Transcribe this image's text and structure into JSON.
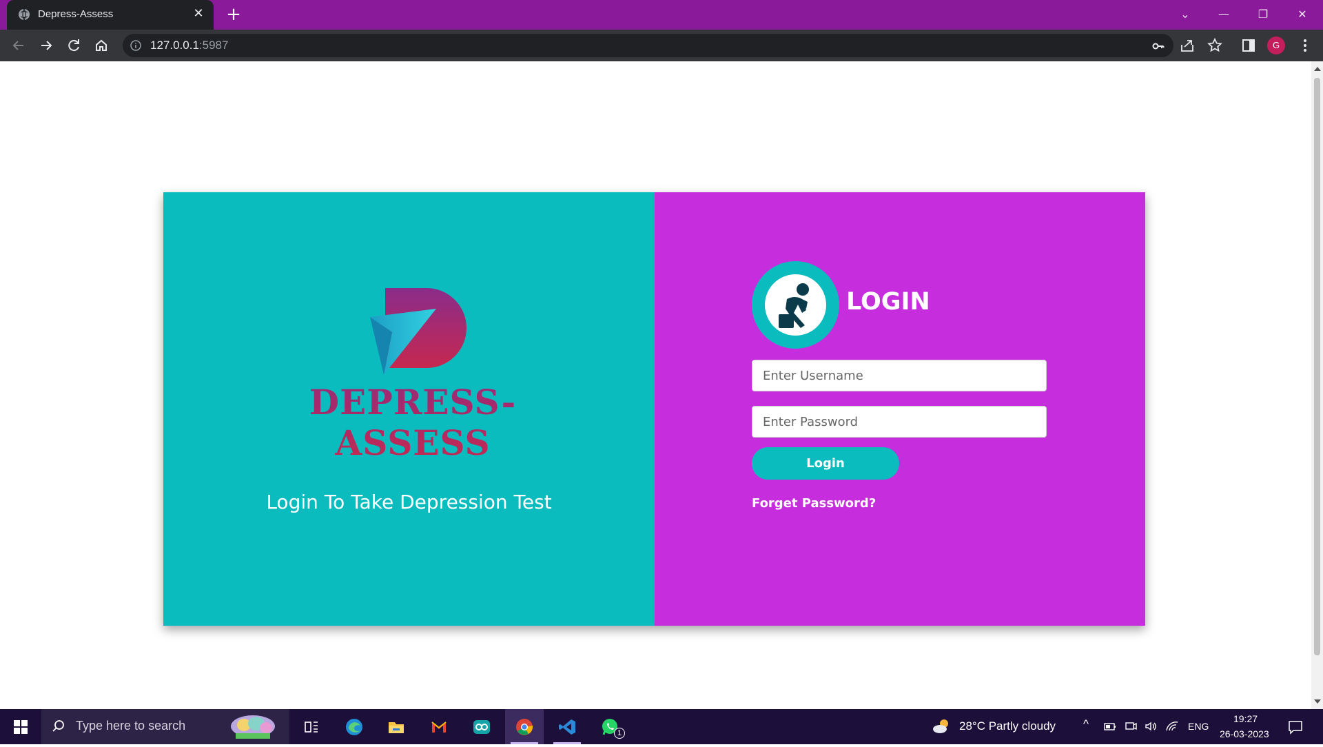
{
  "browser": {
    "tab_title": "Depress-Assess",
    "url_host": "127.0.0.1",
    "url_port": ":5987",
    "avatar_letter": "G"
  },
  "page": {
    "brand": "DEPRESS-ASSESS",
    "tagline": "Login To Take Depression Test",
    "login_title": "LOGIN",
    "username_placeholder": "Enter Username",
    "password_placeholder": "Enter Password",
    "login_button": "Login",
    "forgot_link": "Forget Password?",
    "colors": {
      "left_panel": "#0bbcbf",
      "right_panel": "#c52ddd",
      "brand_text": "#b0275f"
    }
  },
  "taskbar": {
    "search_placeholder": "Type here to search",
    "weather": "28°C  Partly cloudy",
    "language": "ENG",
    "time": "19:27",
    "date": "26-03-2023",
    "whatsapp_badge": "1",
    "apps": [
      "task-view",
      "edge",
      "file-explorer",
      "gmail",
      "arduino",
      "chrome",
      "vscode",
      "whatsapp"
    ]
  }
}
